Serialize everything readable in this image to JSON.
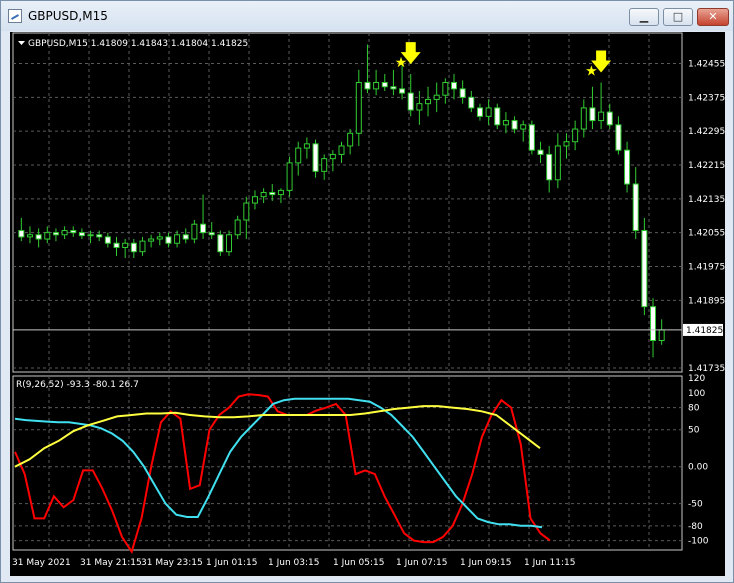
{
  "window": {
    "title": "GBPUSD,M15",
    "minimize_glyph": "▁",
    "maximize_glyph": "□",
    "close_glyph": "✕"
  },
  "main_chart": {
    "symbol_label": "GBPUSD,M15  1.41809 1.41843 1.41804 1.41825",
    "price_ticks": [
      "1.42455",
      "1.42375",
      "1.42295",
      "1.42215",
      "1.42135",
      "1.42055",
      "1.41975",
      "1.41895",
      "1.41735"
    ],
    "current_price": "1.41825",
    "bull_color": "#32cd32",
    "bear_color": "#ffffff",
    "signal_color": "#ffff00"
  },
  "indicator": {
    "label": "R(9,26,52) -93.3 -80.1 26.7",
    "ticks": [
      "120",
      "100",
      "80",
      "50",
      "0.00",
      "-50",
      "-80",
      "-100"
    ],
    "colors": {
      "red": "#ff0000",
      "cyan": "#40e0f0",
      "yellow": "#ffff40"
    }
  },
  "time_labels": [
    "31 May 2021",
    "31 May 21:15",
    "31 May 23:15",
    "1 Jun 01:15",
    "1 Jun 03:15",
    "1 Jun 05:15",
    "1 Jun 07:15",
    "1 Jun 09:15",
    "1 Jun 11:15"
  ],
  "chart_data": {
    "type": "candlestick",
    "symbol": "GBPUSD",
    "timeframe": "M15",
    "ylim": [
      1.41735,
      1.4252
    ],
    "candles": [
      [
        1.4206,
        1.4209,
        1.42035,
        1.42045
      ],
      [
        1.42045,
        1.4207,
        1.4203,
        1.4205
      ],
      [
        1.4205,
        1.42065,
        1.4202,
        1.4204
      ],
      [
        1.4204,
        1.4207,
        1.4203,
        1.42055
      ],
      [
        1.42055,
        1.42065,
        1.42035,
        1.4205
      ],
      [
        1.4205,
        1.4207,
        1.4204,
        1.4206
      ],
      [
        1.4206,
        1.4207,
        1.42045,
        1.42055
      ],
      [
        1.42055,
        1.42065,
        1.4204,
        1.42048
      ],
      [
        1.42048,
        1.4206,
        1.4203,
        1.4205
      ],
      [
        1.4205,
        1.4206,
        1.42035,
        1.42045
      ],
      [
        1.42045,
        1.42055,
        1.4202,
        1.4203
      ],
      [
        1.4203,
        1.42045,
        1.42,
        1.4202
      ],
      [
        1.4202,
        1.4204,
        1.41995,
        1.4203
      ],
      [
        1.4203,
        1.4204,
        1.41995,
        1.4201
      ],
      [
        1.4201,
        1.42045,
        1.42,
        1.42035
      ],
      [
        1.42035,
        1.4205,
        1.4202,
        1.4204
      ],
      [
        1.4204,
        1.42055,
        1.42025,
        1.42045
      ],
      [
        1.42045,
        1.42055,
        1.4202,
        1.4203
      ],
      [
        1.4203,
        1.4206,
        1.4202,
        1.4205
      ],
      [
        1.4205,
        1.42065,
        1.4203,
        1.4204
      ],
      [
        1.4204,
        1.42085,
        1.4203,
        1.42075
      ],
      [
        1.42075,
        1.42145,
        1.4204,
        1.42055
      ],
      [
        1.42055,
        1.4208,
        1.4204,
        1.4205
      ],
      [
        1.4205,
        1.4206,
        1.42,
        1.4201
      ],
      [
        1.4201,
        1.4206,
        1.42,
        1.4205
      ],
      [
        1.4205,
        1.42095,
        1.4204,
        1.42085
      ],
      [
        1.42085,
        1.4214,
        1.4204,
        1.42125
      ],
      [
        1.42125,
        1.42155,
        1.4211,
        1.4214
      ],
      [
        1.4214,
        1.4216,
        1.42125,
        1.4215
      ],
      [
        1.4215,
        1.4217,
        1.4213,
        1.42145
      ],
      [
        1.42145,
        1.4216,
        1.42125,
        1.42155
      ],
      [
        1.42155,
        1.42235,
        1.4214,
        1.4222
      ],
      [
        1.4222,
        1.4227,
        1.4219,
        1.42255
      ],
      [
        1.42255,
        1.4228,
        1.4223,
        1.42265
      ],
      [
        1.42265,
        1.42275,
        1.42185,
        1.422
      ],
      [
        1.422,
        1.4224,
        1.4218,
        1.4223
      ],
      [
        1.4223,
        1.4225,
        1.422,
        1.4224
      ],
      [
        1.4224,
        1.4227,
        1.4222,
        1.4226
      ],
      [
        1.4226,
        1.423,
        1.4224,
        1.4229
      ],
      [
        1.4229,
        1.4244,
        1.4226,
        1.4241
      ],
      [
        1.4241,
        1.425,
        1.42385,
        1.42395
      ],
      [
        1.42395,
        1.4244,
        1.4238,
        1.4241
      ],
      [
        1.4241,
        1.4243,
        1.4239,
        1.424
      ],
      [
        1.424,
        1.4244,
        1.4238,
        1.42395
      ],
      [
        1.42395,
        1.4245,
        1.4237,
        1.42385
      ],
      [
        1.42385,
        1.4243,
        1.4233,
        1.42345
      ],
      [
        1.42345,
        1.4239,
        1.4231,
        1.4236
      ],
      [
        1.4236,
        1.424,
        1.4233,
        1.4237
      ],
      [
        1.4237,
        1.4241,
        1.4234,
        1.4238
      ],
      [
        1.4238,
        1.4242,
        1.4236,
        1.4241
      ],
      [
        1.4241,
        1.4243,
        1.4237,
        1.42395
      ],
      [
        1.42395,
        1.42415,
        1.4236,
        1.42375
      ],
      [
        1.42375,
        1.4239,
        1.4234,
        1.4235
      ],
      [
        1.4235,
        1.4236,
        1.4232,
        1.4233
      ],
      [
        1.4233,
        1.4237,
        1.4231,
        1.4235
      ],
      [
        1.4235,
        1.4236,
        1.423,
        1.4231
      ],
      [
        1.4231,
        1.4234,
        1.4229,
        1.4232
      ],
      [
        1.4232,
        1.4233,
        1.4229,
        1.423
      ],
      [
        1.423,
        1.4232,
        1.4227,
        1.4231
      ],
      [
        1.4231,
        1.4232,
        1.4224,
        1.4225
      ],
      [
        1.4225,
        1.4227,
        1.4222,
        1.4224
      ],
      [
        1.4224,
        1.4226,
        1.4215,
        1.4218
      ],
      [
        1.4218,
        1.4229,
        1.4216,
        1.4226
      ],
      [
        1.4226,
        1.4229,
        1.4223,
        1.4227
      ],
      [
        1.4227,
        1.4232,
        1.4225,
        1.423
      ],
      [
        1.423,
        1.4237,
        1.4228,
        1.4235
      ],
      [
        1.4235,
        1.424,
        1.423,
        1.4232
      ],
      [
        1.4232,
        1.4241,
        1.423,
        1.4234
      ],
      [
        1.4234,
        1.4236,
        1.423,
        1.4231
      ],
      [
        1.4231,
        1.4233,
        1.4224,
        1.4225
      ],
      [
        1.4225,
        1.4227,
        1.4215,
        1.4217
      ],
      [
        1.4217,
        1.4221,
        1.4204,
        1.4206
      ],
      [
        1.4206,
        1.4209,
        1.4186,
        1.4188
      ],
      [
        1.4188,
        1.419,
        1.4176,
        1.418
      ],
      [
        1.418,
        1.4185,
        1.4179,
        1.41825
      ]
    ],
    "signals": [
      {
        "candle": 45,
        "type": "sell-arrow"
      },
      {
        "candle": 67,
        "type": "sell-arrow"
      }
    ],
    "indicator_series": [
      {
        "color": "red",
        "values": [
          20,
          -10,
          -70,
          -70,
          -40,
          -55,
          -45,
          -5,
          -5,
          -30,
          -60,
          -95,
          -115,
          -70,
          0,
          60,
          75,
          65,
          -30,
          -25,
          50,
          70,
          80,
          95,
          98,
          97,
          95,
          75,
          70,
          70,
          70,
          76,
          80,
          85,
          70,
          -10,
          -5,
          -10,
          -40,
          -65,
          -90,
          -100,
          -102,
          -102,
          -95,
          -80,
          -50,
          -10,
          40,
          70,
          90,
          80,
          30,
          -70,
          -90,
          -100
        ]
      },
      {
        "color": "cyan",
        "values": [
          65,
          63,
          62,
          61,
          60,
          60,
          58,
          56,
          52,
          45,
          35,
          20,
          0,
          -25,
          -50,
          -65,
          -68,
          -68,
          -40,
          -10,
          20,
          40,
          55,
          70,
          85,
          90,
          92,
          92,
          92,
          92,
          92,
          92,
          90,
          88,
          80,
          70,
          55,
          40,
          20,
          0,
          -20,
          -40,
          -55,
          -70,
          -75,
          -78,
          -78,
          -80,
          -80,
          -82
        ]
      },
      {
        "color": "yellow",
        "values": [
          0,
          10,
          25,
          35,
          48,
          56,
          62,
          68,
          70,
          72,
          72,
          73,
          70,
          68,
          67,
          67,
          68,
          70,
          70,
          70,
          70,
          70,
          70,
          70,
          72,
          75,
          78,
          80,
          82,
          82,
          80,
          78,
          75,
          70,
          55,
          40,
          25
        ]
      }
    ]
  }
}
